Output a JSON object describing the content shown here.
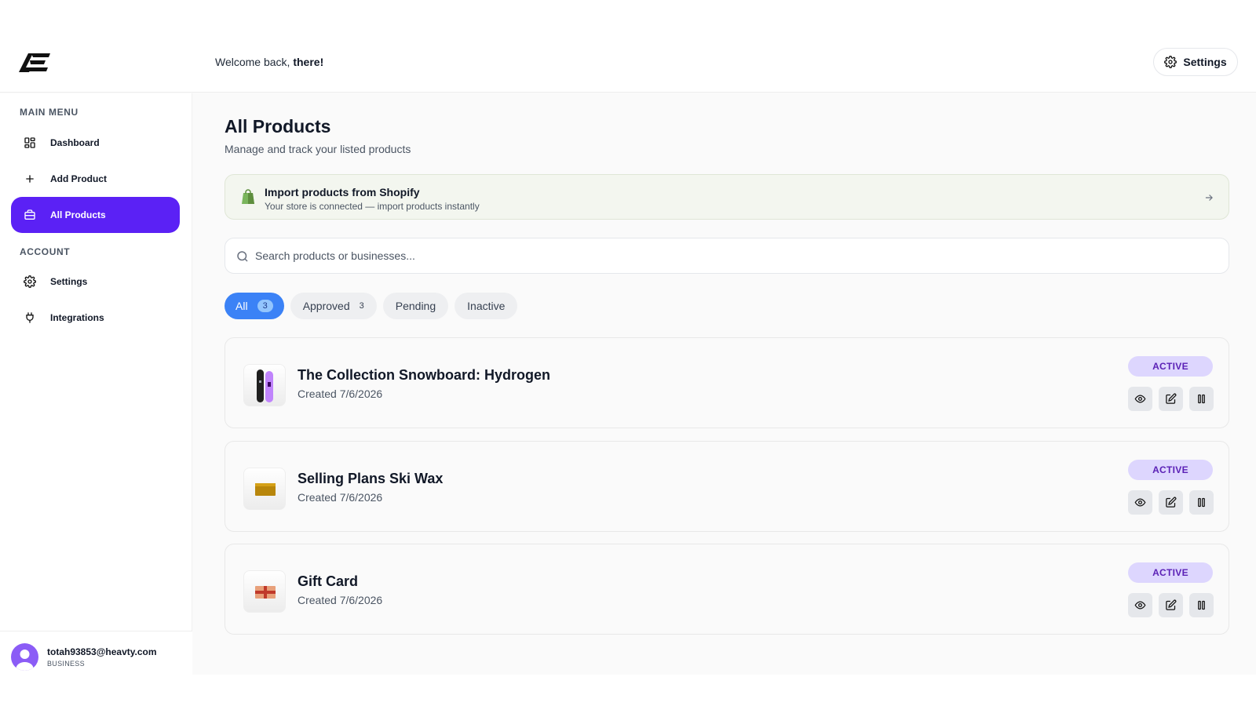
{
  "header": {
    "welcome_prefix": "Welcome back, ",
    "welcome_name": "there!",
    "settings_label": "Settings"
  },
  "sidebar": {
    "main_menu_label": "MAIN MENU",
    "account_label": "ACCOUNT",
    "items": [
      {
        "label": "Dashboard",
        "icon": "dashboard-icon"
      },
      {
        "label": "Add Product",
        "icon": "plus-icon"
      },
      {
        "label": "All Products",
        "icon": "briefcase-icon",
        "active": true
      },
      {
        "label": "Settings",
        "icon": "gear-icon"
      },
      {
        "label": "Integrations",
        "icon": "plug-icon"
      }
    ],
    "user": {
      "email": "totah93853@heavty.com",
      "role": "BUSINESS"
    }
  },
  "main": {
    "title": "All Products",
    "subtitle": "Manage and track your listed products",
    "shopify": {
      "title": "Import products from Shopify",
      "subtitle": "Your store is connected — import products instantly"
    },
    "search": {
      "placeholder": "Search products or businesses...",
      "value": ""
    },
    "tabs": [
      {
        "label": "All",
        "count": "3",
        "active": true
      },
      {
        "label": "Approved",
        "count": "3"
      },
      {
        "label": "Pending",
        "count": ""
      },
      {
        "label": "Inactive",
        "count": ""
      }
    ],
    "products": [
      {
        "title": "The Collection Snowboard: Hydrogen",
        "date": "Created 7/6/2026",
        "status": "ACTIVE"
      },
      {
        "title": "Selling Plans Ski Wax",
        "date": "Created 7/6/2026",
        "status": "ACTIVE"
      },
      {
        "title": "Gift Card",
        "date": "Created 7/6/2026",
        "status": "ACTIVE"
      }
    ]
  },
  "colors": {
    "accent": "#5b21f5",
    "tab_active": "#3b82f6",
    "badge_bg": "#ddd6fe",
    "badge_text": "#5b21b6"
  }
}
